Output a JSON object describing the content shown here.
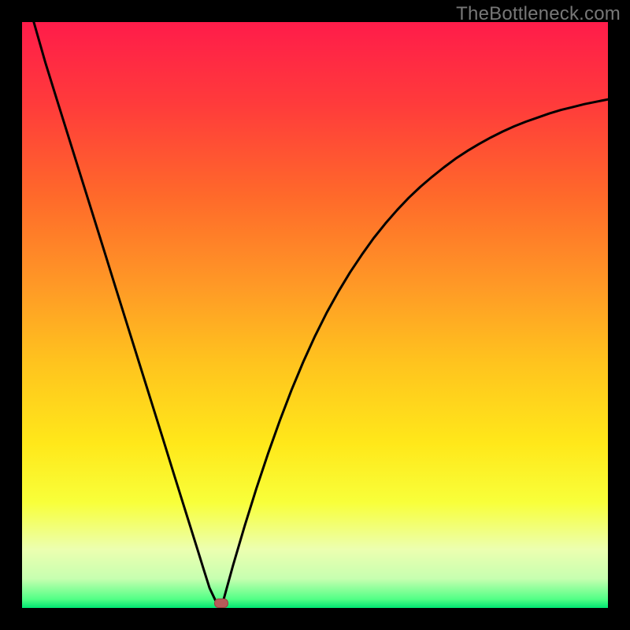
{
  "watermark": "TheBottleneck.com",
  "colors": {
    "frame": "#000000",
    "gradient_stops": [
      {
        "offset": 0.0,
        "color": "#ff1c4a"
      },
      {
        "offset": 0.14,
        "color": "#ff3b3b"
      },
      {
        "offset": 0.3,
        "color": "#ff6a2a"
      },
      {
        "offset": 0.45,
        "color": "#ff9926"
      },
      {
        "offset": 0.58,
        "color": "#ffc31e"
      },
      {
        "offset": 0.72,
        "color": "#ffe81a"
      },
      {
        "offset": 0.82,
        "color": "#f8ff3a"
      },
      {
        "offset": 0.9,
        "color": "#ecffb0"
      },
      {
        "offset": 0.95,
        "color": "#c7ffb0"
      },
      {
        "offset": 0.985,
        "color": "#52ff86"
      },
      {
        "offset": 1.0,
        "color": "#00e572"
      }
    ],
    "curve": "#000000",
    "marker_fill": "#b85a5a",
    "marker_stroke": "#9c4040"
  },
  "chart_data": {
    "type": "line",
    "title": "",
    "xlabel": "",
    "ylabel": "",
    "xlim": [
      0,
      100
    ],
    "ylim": [
      0,
      100
    ],
    "grid": false,
    "legend": false,
    "x": [
      2,
      4,
      6,
      8,
      10,
      12,
      14,
      16,
      18,
      20,
      22,
      24,
      26,
      28,
      30,
      31,
      32,
      33,
      34,
      36,
      38,
      40,
      42,
      44,
      46,
      48,
      50,
      52,
      54,
      56,
      58,
      60,
      62,
      64,
      66,
      68,
      70,
      72,
      74,
      76,
      78,
      80,
      82,
      84,
      86,
      88,
      90,
      92,
      94,
      96,
      98,
      100
    ],
    "values": [
      100,
      93.0,
      86.6,
      80.2,
      73.8,
      67.4,
      61.0,
      54.6,
      48.2,
      41.8,
      35.4,
      29.0,
      22.6,
      16.2,
      9.8,
      6.6,
      3.4,
      1.3,
      0.0,
      7.2,
      14.0,
      20.4,
      26.4,
      32.0,
      37.2,
      42.0,
      46.4,
      50.4,
      54.0,
      57.3,
      60.3,
      63.1,
      65.6,
      67.9,
      70.0,
      71.9,
      73.6,
      75.2,
      76.7,
      78.0,
      79.2,
      80.3,
      81.3,
      82.2,
      83.0,
      83.7,
      84.4,
      85.0,
      85.5,
      86.0,
      86.4,
      86.8
    ],
    "marker": {
      "x": 34,
      "y": 0.8,
      "shape": "rounded-rect"
    }
  }
}
